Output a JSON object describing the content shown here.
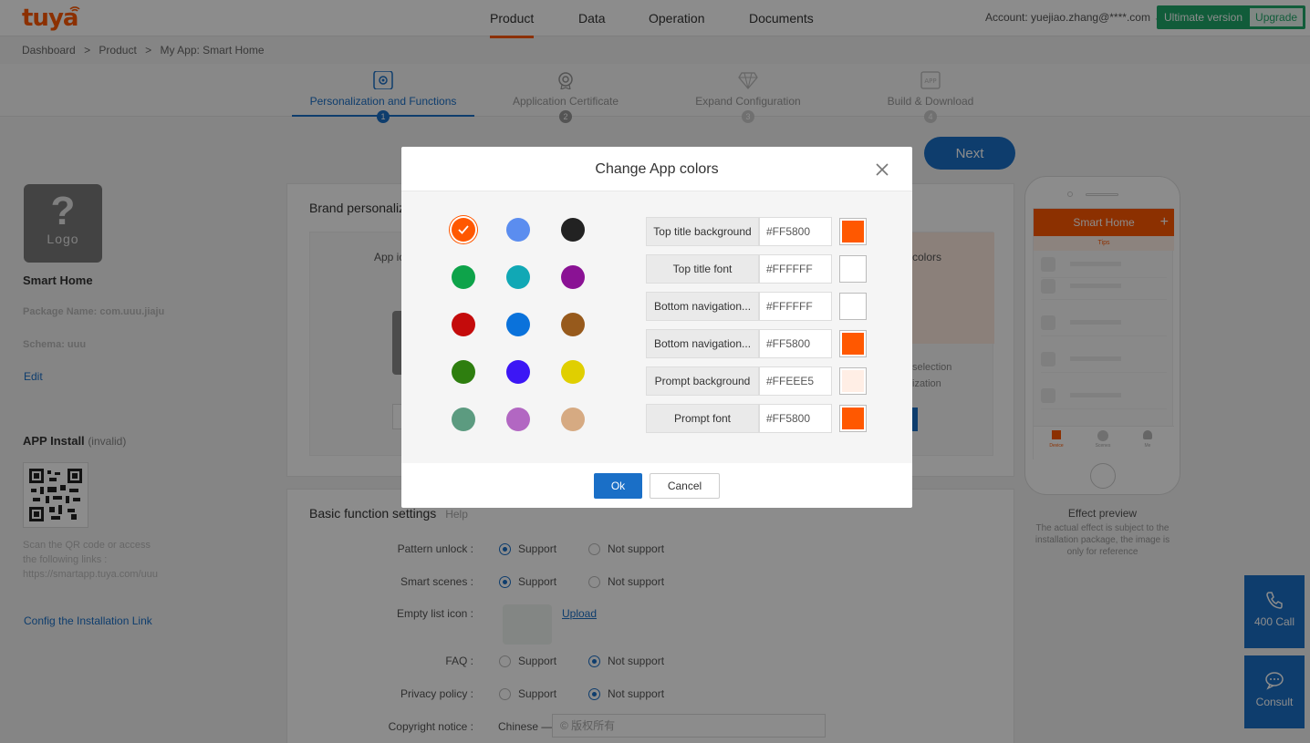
{
  "header": {
    "logo": "tuya",
    "nav": [
      "Product",
      "Data",
      "Operation",
      "Documents"
    ],
    "account": "Account: yuejiao.zhang@****.com",
    "ultimate": "Ultimate version",
    "upgrade": "Upgrade"
  },
  "breadcrumb": [
    "Dashboard",
    ">",
    "Product",
    ">",
    "My App: Smart Home"
  ],
  "steps": [
    {
      "label": "Personalization and Functions",
      "num": "1",
      "icon": "gear-icon"
    },
    {
      "label": "Application Certificate",
      "num": "2",
      "icon": "certificate-icon"
    },
    {
      "label": "Expand Configuration",
      "num": "3",
      "icon": "diamond-icon"
    },
    {
      "label": "Build & Download",
      "num": "4",
      "icon": "app-icon"
    }
  ],
  "next": "Next",
  "left": {
    "logo_text": "Logo",
    "logo_q": "?",
    "app_name": "Smart Home",
    "package": "Package Name: com.uuu.jiaju",
    "scheme": "Schema: uuu",
    "edit": "Edit",
    "install": "APP Install",
    "install_status": "(invalid)",
    "scan": "Scan the QR code or access the following links :",
    "link": "https://smartapp.tuya.com/uuu",
    "config": "Config the Installation Link"
  },
  "brand_card": {
    "title": "Brand personalization",
    "app_icon": "App icon",
    "colors_label": "colors",
    "selection": "selection",
    "ization": "ization"
  },
  "basic": {
    "title": "Basic function settings",
    "help": "Help",
    "rows": [
      {
        "label": "Pattern unlock :",
        "opt1": "Support",
        "opt2": "Not support",
        "selected": 1
      },
      {
        "label": "Smart scenes :",
        "opt1": "Support",
        "opt2": "Not support",
        "selected": 1
      },
      {
        "label": "Empty list icon :",
        "upload": "Upload"
      },
      {
        "label": "FAQ :",
        "opt1": "Support",
        "opt2": "Not support",
        "selected": 2
      },
      {
        "label": "Privacy policy :",
        "opt1": "Support",
        "opt2": "Not support",
        "selected": 2
      },
      {
        "label": "Copyright notice :",
        "lang": "Chinese —",
        "placeholder": "© 版权所有"
      }
    ]
  },
  "preview": {
    "title": "Smart Home",
    "tips": "Tips",
    "tabs": [
      "Device",
      "Scenes",
      "Me"
    ],
    "effect": "Effect preview",
    "note": "The actual effect is subject to the installation package, the image is only for reference"
  },
  "side": {
    "call": "400 Call",
    "consult": "Consult"
  },
  "modal": {
    "title": "Change App colors",
    "swatches": [
      [
        "#ff5800",
        "#5b8def",
        "#222222"
      ],
      [
        "#0ea34a",
        "#11a8b5",
        "#8a1294"
      ],
      [
        "#c40b0b",
        "#0a72db",
        "#975a1c"
      ],
      [
        "#2e7e0f",
        "#3c16f5",
        "#e0cf00"
      ],
      [
        "#5c9b80",
        "#b267c2",
        "#d6aa82"
      ]
    ],
    "props": [
      {
        "label": "Top title background",
        "value": "#FF5800",
        "color": "#FF5800"
      },
      {
        "label": "Top title font",
        "value": "#FFFFFF",
        "color": "#FFFFFF"
      },
      {
        "label": "Bottom navigation...",
        "value": "#FFFFFF",
        "color": "#FFFFFF"
      },
      {
        "label": "Bottom navigation...",
        "value": "#FF5800",
        "color": "#FF5800"
      },
      {
        "label": "Prompt background",
        "value": "#FFEEE5",
        "color": "#FFEEE5"
      },
      {
        "label": "Prompt font",
        "value": "#FF5800",
        "color": "#FF5800"
      }
    ],
    "ok": "Ok",
    "cancel": "Cancel"
  }
}
